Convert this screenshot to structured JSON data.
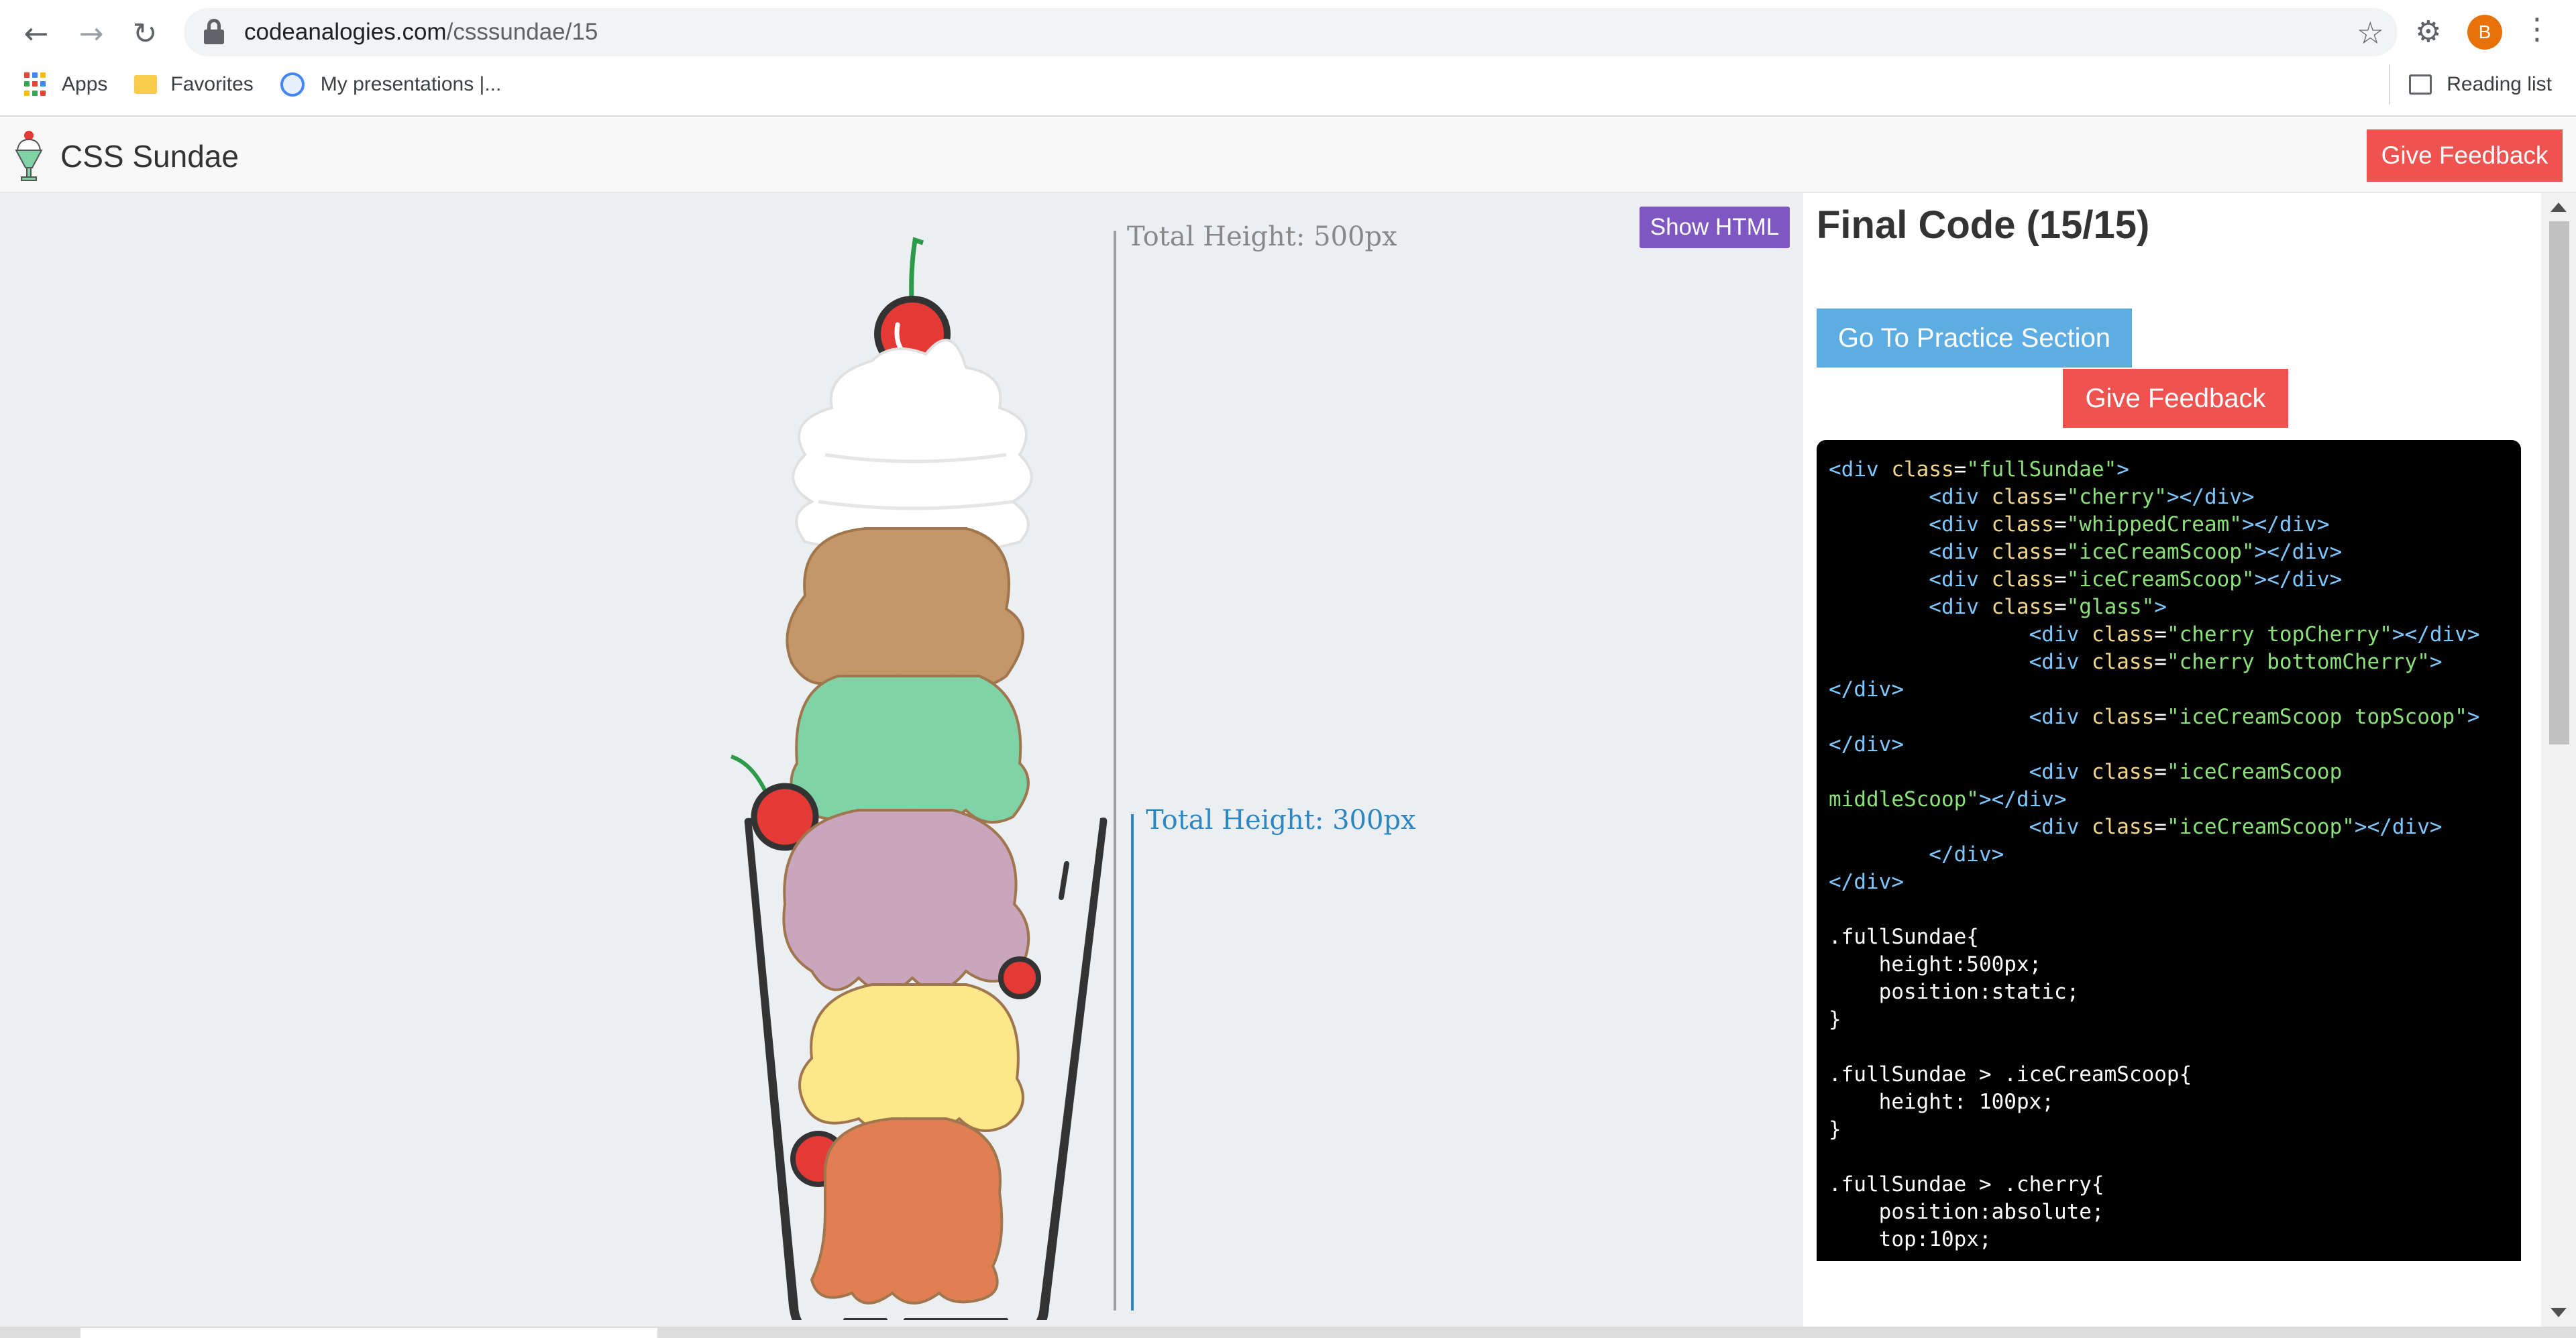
{
  "browser": {
    "url_domain": "codeanalogies.com",
    "url_path": "/csssundae/15",
    "profile_initial": "B",
    "bookmarks": [
      {
        "label": "Apps",
        "icon": "apps-grid-icon"
      },
      {
        "label": "Favorites",
        "icon": "folder-icon"
      },
      {
        "label": "My presentations |...",
        "icon": "globe-icon"
      }
    ],
    "reading_list": "Reading list"
  },
  "header": {
    "brand": "CSS Sundae",
    "feedback_label": "Give Feedback",
    "feedback_color": "#ef5350"
  },
  "stage": {
    "show_html_label": "Show HTML",
    "total_height_outer": "Total Height: 500px",
    "total_height_inner": "Total Height: 300px",
    "colors": {
      "whipped_cream": "#ffffff",
      "scoop_top": "#c4976a",
      "scoop_mint": "#7fd3a7",
      "scoop_purple": "#c9a5be",
      "scoop_yellow": "#fde78b",
      "scoop_orange": "#e07f52",
      "cherry": "#e53935",
      "measure_blue": "#2e86c1"
    }
  },
  "panel": {
    "title": "Final Code (15/15)",
    "practice_label": "Go To Practice Section",
    "feedback_label": "Give Feedback",
    "practice_color": "#5dade2"
  },
  "code_lines": [
    [
      {
        "t": "<div ",
        "c": "tg"
      },
      {
        "t": "class",
        "c": "at"
      },
      {
        "t": "=",
        "c": ""
      },
      {
        "t": "\"fullSundae\"",
        "c": "st"
      },
      {
        "t": ">",
        "c": "tg"
      }
    ],
    [
      {
        "t": "        <div ",
        "c": "tg"
      },
      {
        "t": "class",
        "c": "at"
      },
      {
        "t": "=",
        "c": ""
      },
      {
        "t": "\"cherry\"",
        "c": "st"
      },
      {
        "t": "></div>",
        "c": "tg"
      }
    ],
    [
      {
        "t": "        <div ",
        "c": "tg"
      },
      {
        "t": "class",
        "c": "at"
      },
      {
        "t": "=",
        "c": ""
      },
      {
        "t": "\"whippedCream\"",
        "c": "st"
      },
      {
        "t": "></div>",
        "c": "tg"
      }
    ],
    [
      {
        "t": "        <div ",
        "c": "tg"
      },
      {
        "t": "class",
        "c": "at"
      },
      {
        "t": "=",
        "c": ""
      },
      {
        "t": "\"iceCreamScoop\"",
        "c": "st"
      },
      {
        "t": "></div>",
        "c": "tg"
      }
    ],
    [
      {
        "t": "        <div ",
        "c": "tg"
      },
      {
        "t": "class",
        "c": "at"
      },
      {
        "t": "=",
        "c": ""
      },
      {
        "t": "\"iceCreamScoop\"",
        "c": "st"
      },
      {
        "t": "></div>",
        "c": "tg"
      }
    ],
    [
      {
        "t": "        <div ",
        "c": "tg"
      },
      {
        "t": "class",
        "c": "at"
      },
      {
        "t": "=",
        "c": ""
      },
      {
        "t": "\"glass\"",
        "c": "st"
      },
      {
        "t": ">",
        "c": "tg"
      }
    ],
    [
      {
        "t": "                <div ",
        "c": "tg"
      },
      {
        "t": "class",
        "c": "at"
      },
      {
        "t": "=",
        "c": ""
      },
      {
        "t": "\"cherry topCherry\"",
        "c": "st"
      },
      {
        "t": "></div>",
        "c": "tg"
      }
    ],
    [
      {
        "t": "                <div ",
        "c": "tg"
      },
      {
        "t": "class",
        "c": "at"
      },
      {
        "t": "=",
        "c": ""
      },
      {
        "t": "\"cherry bottomCherry\"",
        "c": "st"
      },
      {
        "t": ">",
        "c": "tg"
      }
    ],
    [
      {
        "t": "</div>",
        "c": "tg"
      }
    ],
    [
      {
        "t": "                <div ",
        "c": "tg"
      },
      {
        "t": "class",
        "c": "at"
      },
      {
        "t": "=",
        "c": ""
      },
      {
        "t": "\"iceCreamScoop topScoop\"",
        "c": "st"
      },
      {
        "t": ">",
        "c": "tg"
      }
    ],
    [
      {
        "t": "</div>",
        "c": "tg"
      }
    ],
    [
      {
        "t": "                <div ",
        "c": "tg"
      },
      {
        "t": "class",
        "c": "at"
      },
      {
        "t": "=",
        "c": ""
      },
      {
        "t": "\"iceCreamScoop",
        "c": "st"
      }
    ],
    [
      {
        "t": "middleScoop\"",
        "c": "st"
      },
      {
        "t": "></div>",
        "c": "tg"
      }
    ],
    [
      {
        "t": "                <div ",
        "c": "tg"
      },
      {
        "t": "class",
        "c": "at"
      },
      {
        "t": "=",
        "c": ""
      },
      {
        "t": "\"iceCreamScoop\"",
        "c": "st"
      },
      {
        "t": "></div>",
        "c": "tg"
      }
    ],
    [
      {
        "t": "        </div>",
        "c": "tg"
      }
    ],
    [
      {
        "t": "</div>",
        "c": "tg"
      }
    ],
    [
      {
        "t": "",
        "c": ""
      }
    ],
    [
      {
        "t": ".fullSundae{",
        "c": ""
      }
    ],
    [
      {
        "t": "    height:500px;",
        "c": ""
      }
    ],
    [
      {
        "t": "    position:static;",
        "c": ""
      }
    ],
    [
      {
        "t": "}",
        "c": ""
      }
    ],
    [
      {
        "t": "",
        "c": ""
      }
    ],
    [
      {
        "t": ".fullSundae > .iceCreamScoop{",
        "c": ""
      }
    ],
    [
      {
        "t": "    height: 100px;",
        "c": ""
      }
    ],
    [
      {
        "t": "}",
        "c": ""
      }
    ],
    [
      {
        "t": "",
        "c": ""
      }
    ],
    [
      {
        "t": ".fullSundae > .cherry{",
        "c": ""
      }
    ],
    [
      {
        "t": "    position:absolute;",
        "c": ""
      }
    ],
    [
      {
        "t": "    top:10px;",
        "c": ""
      }
    ]
  ]
}
